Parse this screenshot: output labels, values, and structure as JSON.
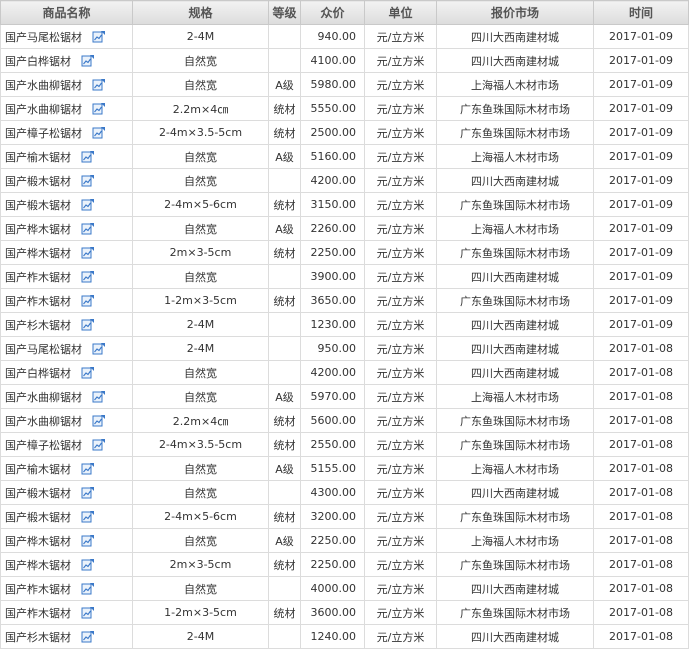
{
  "table": {
    "headers": [
      "商品名称",
      "规格",
      "等级",
      "众价",
      "单位",
      "报价市场",
      "时间"
    ],
    "rows": [
      {
        "name": "国产马尾松锯材",
        "spec": "2-4M",
        "grade": "",
        "price": "940.00",
        "unit": "元/立方米",
        "market": "四川大西南建材城",
        "date": "2017-01-09"
      },
      {
        "name": "国产白桦锯材",
        "spec": "自然宽",
        "grade": "",
        "price": "4100.00",
        "unit": "元/立方米",
        "market": "四川大西南建材城",
        "date": "2017-01-09"
      },
      {
        "name": "国产水曲柳锯材",
        "spec": "自然宽",
        "grade": "A级",
        "price": "5980.00",
        "unit": "元/立方米",
        "market": "上海福人木材市场",
        "date": "2017-01-09"
      },
      {
        "name": "国产水曲柳锯材",
        "spec": "2.2m×4㎝",
        "grade": "统材",
        "price": "5550.00",
        "unit": "元/立方米",
        "market": "广东鱼珠国际木材市场",
        "date": "2017-01-09"
      },
      {
        "name": "国产樟子松锯材",
        "spec": "2-4m×3.5-5cm",
        "grade": "统材",
        "price": "2500.00",
        "unit": "元/立方米",
        "market": "广东鱼珠国际木材市场",
        "date": "2017-01-09"
      },
      {
        "name": "国产榆木锯材",
        "spec": "自然宽",
        "grade": "A级",
        "price": "5160.00",
        "unit": "元/立方米",
        "market": "上海福人木材市场",
        "date": "2017-01-09"
      },
      {
        "name": "国产椴木锯材",
        "spec": "自然宽",
        "grade": "",
        "price": "4200.00",
        "unit": "元/立方米",
        "market": "四川大西南建材城",
        "date": "2017-01-09"
      },
      {
        "name": "国产椴木锯材",
        "spec": "2-4m×5-6cm",
        "grade": "统材",
        "price": "3150.00",
        "unit": "元/立方米",
        "market": "广东鱼珠国际木材市场",
        "date": "2017-01-09"
      },
      {
        "name": "国产桦木锯材",
        "spec": "自然宽",
        "grade": "A级",
        "price": "2260.00",
        "unit": "元/立方米",
        "market": "上海福人木材市场",
        "date": "2017-01-09"
      },
      {
        "name": "国产桦木锯材",
        "spec": "2m×3-5cm",
        "grade": "统材",
        "price": "2250.00",
        "unit": "元/立方米",
        "market": "广东鱼珠国际木材市场",
        "date": "2017-01-09"
      },
      {
        "name": "国产柞木锯材",
        "spec": "自然宽",
        "grade": "",
        "price": "3900.00",
        "unit": "元/立方米",
        "market": "四川大西南建材城",
        "date": "2017-01-09"
      },
      {
        "name": "国产柞木锯材",
        "spec": "1-2m×3-5cm",
        "grade": "统材",
        "price": "3650.00",
        "unit": "元/立方米",
        "market": "广东鱼珠国际木材市场",
        "date": "2017-01-09"
      },
      {
        "name": "国产杉木锯材",
        "spec": "2-4M",
        "grade": "",
        "price": "1230.00",
        "unit": "元/立方米",
        "market": "四川大西南建材城",
        "date": "2017-01-09"
      },
      {
        "name": "国产马尾松锯材",
        "spec": "2-4M",
        "grade": "",
        "price": "950.00",
        "unit": "元/立方米",
        "market": "四川大西南建材城",
        "date": "2017-01-08"
      },
      {
        "name": "国产白桦锯材",
        "spec": "自然宽",
        "grade": "",
        "price": "4200.00",
        "unit": "元/立方米",
        "market": "四川大西南建材城",
        "date": "2017-01-08"
      },
      {
        "name": "国产水曲柳锯材",
        "spec": "自然宽",
        "grade": "A级",
        "price": "5970.00",
        "unit": "元/立方米",
        "market": "上海福人木材市场",
        "date": "2017-01-08"
      },
      {
        "name": "国产水曲柳锯材",
        "spec": "2.2m×4㎝",
        "grade": "统材",
        "price": "5600.00",
        "unit": "元/立方米",
        "market": "广东鱼珠国际木材市场",
        "date": "2017-01-08"
      },
      {
        "name": "国产樟子松锯材",
        "spec": "2-4m×3.5-5cm",
        "grade": "统材",
        "price": "2550.00",
        "unit": "元/立方米",
        "market": "广东鱼珠国际木材市场",
        "date": "2017-01-08"
      },
      {
        "name": "国产榆木锯材",
        "spec": "自然宽",
        "grade": "A级",
        "price": "5155.00",
        "unit": "元/立方米",
        "market": "上海福人木材市场",
        "date": "2017-01-08"
      },
      {
        "name": "国产椴木锯材",
        "spec": "自然宽",
        "grade": "",
        "price": "4300.00",
        "unit": "元/立方米",
        "market": "四川大西南建材城",
        "date": "2017-01-08"
      },
      {
        "name": "国产椴木锯材",
        "spec": "2-4m×5-6cm",
        "grade": "统材",
        "price": "3200.00",
        "unit": "元/立方米",
        "market": "广东鱼珠国际木材市场",
        "date": "2017-01-08"
      },
      {
        "name": "国产桦木锯材",
        "spec": "自然宽",
        "grade": "A级",
        "price": "2250.00",
        "unit": "元/立方米",
        "market": "上海福人木材市场",
        "date": "2017-01-08"
      },
      {
        "name": "国产桦木锯材",
        "spec": "2m×3-5cm",
        "grade": "统材",
        "price": "2250.00",
        "unit": "元/立方米",
        "market": "广东鱼珠国际木材市场",
        "date": "2017-01-08"
      },
      {
        "name": "国产柞木锯材",
        "spec": "自然宽",
        "grade": "",
        "price": "4000.00",
        "unit": "元/立方米",
        "market": "四川大西南建材城",
        "date": "2017-01-08"
      },
      {
        "name": "国产柞木锯材",
        "spec": "1-2m×3-5cm",
        "grade": "统材",
        "price": "3600.00",
        "unit": "元/立方米",
        "market": "广东鱼珠国际木材市场",
        "date": "2017-01-08"
      },
      {
        "name": "国产杉木锯材",
        "spec": "2-4M",
        "grade": "",
        "price": "1240.00",
        "unit": "元/立方米",
        "market": "四川大西南建材城",
        "date": "2017-01-08"
      }
    ]
  },
  "icons": {
    "row_icon": "price-chart-icon"
  },
  "colors": {
    "header_bg": "#e4e4e4",
    "border": "#dcdcdc",
    "icon_blue": "#3a78c8"
  }
}
